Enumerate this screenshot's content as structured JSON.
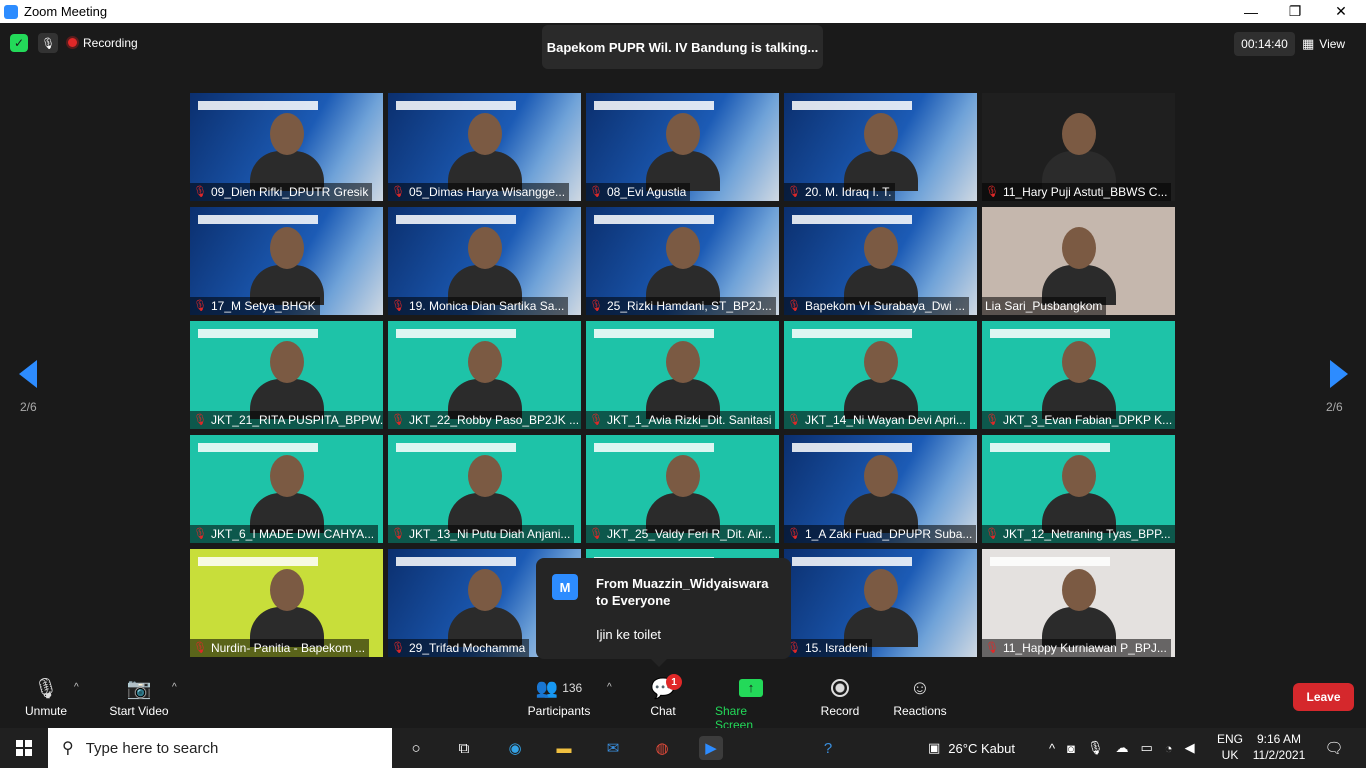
{
  "window": {
    "title": "Zoom Meeting",
    "controls": [
      "—",
      "❐",
      "✕"
    ]
  },
  "header": {
    "recording_label": "Recording",
    "talking_text": "Bapekom PUPR Wil. IV Bandung is talking...",
    "timer": "00:14:40",
    "view_label": "View"
  },
  "pagination": {
    "left": "2/6",
    "right": "2/6"
  },
  "participants": [
    {
      "name": "09_Dien Rifki_DPUTR Gresik",
      "muted": true
    },
    {
      "name": "05_Dimas Harya Wisangge...",
      "muted": true
    },
    {
      "name": "08_Evi Agustia",
      "muted": true
    },
    {
      "name": "20. M. Idraq I. T.",
      "muted": true
    },
    {
      "name": "11_Hary Puji Astuti_BBWS C...",
      "muted": true
    },
    {
      "name": "17_M Setya_BHGK",
      "muted": true
    },
    {
      "name": "19. Monica Dian Sartika Sa...",
      "muted": true
    },
    {
      "name": "25_Rizki Hamdani, ST_BP2J...",
      "muted": true
    },
    {
      "name": "Bapekom VI Surabaya_Dwi ...",
      "muted": true
    },
    {
      "name": "Lia Sari_Pusbangkom",
      "muted": false
    },
    {
      "name": "JKT_21_RITA PUSPITA_BPPW...",
      "muted": true
    },
    {
      "name": "JKT_22_Robby Paso_BP2JK ...",
      "muted": true
    },
    {
      "name": "JKT_1_Avia Rizki_Dit. Sanitasi",
      "muted": true
    },
    {
      "name": "JKT_14_Ni Wayan Devi Apri...",
      "muted": true
    },
    {
      "name": "JKT_3_Evan Fabian_DPKP K...",
      "muted": true
    },
    {
      "name": "JKT_6_I MADE DWI CAHYA...",
      "muted": true
    },
    {
      "name": "JKT_13_Ni Putu Diah Anjani...",
      "muted": true
    },
    {
      "name": "JKT_25_Valdy Feri R_Dit. Air...",
      "muted": true
    },
    {
      "name": "1_A Zaki Fuad_DPUPR Suba...",
      "muted": true
    },
    {
      "name": "JKT_12_Netraning Tyas_BPP...",
      "muted": true
    },
    {
      "name": "Nurdin- Panitia - Bapekom ...",
      "muted": true
    },
    {
      "name": "29_Trifad Mochamma",
      "muted": true
    },
    {
      "name": "",
      "muted": false
    },
    {
      "name": "15. Isradeni",
      "muted": true
    },
    {
      "name": "11_Happy Kurniawan P_BPJ...",
      "muted": true
    }
  ],
  "chat_popup": {
    "avatar_letter": "M",
    "from": "From Muazzin_Widyaiswara to Everyone",
    "message": "Ijin ke toilet"
  },
  "toolbar": {
    "unmute": "Unmute",
    "start_video": "Start Video",
    "participants_count": "136",
    "participants": "Participants",
    "chat": "Chat",
    "chat_badge": "1",
    "share_screen": "Share Screen",
    "record": "Record",
    "reactions": "Reactions",
    "leave": "Leave"
  },
  "taskbar": {
    "search_placeholder": "Type here to search",
    "weather": "26°C  Kabut",
    "lang_top": "ENG",
    "lang_bottom": "UK",
    "time": "9:16 AM",
    "date": "11/2/2021"
  },
  "colors": {
    "accent": "#2d8cff",
    "leave": "#d5282c",
    "share": "#23d959",
    "mute": "#e02828"
  }
}
